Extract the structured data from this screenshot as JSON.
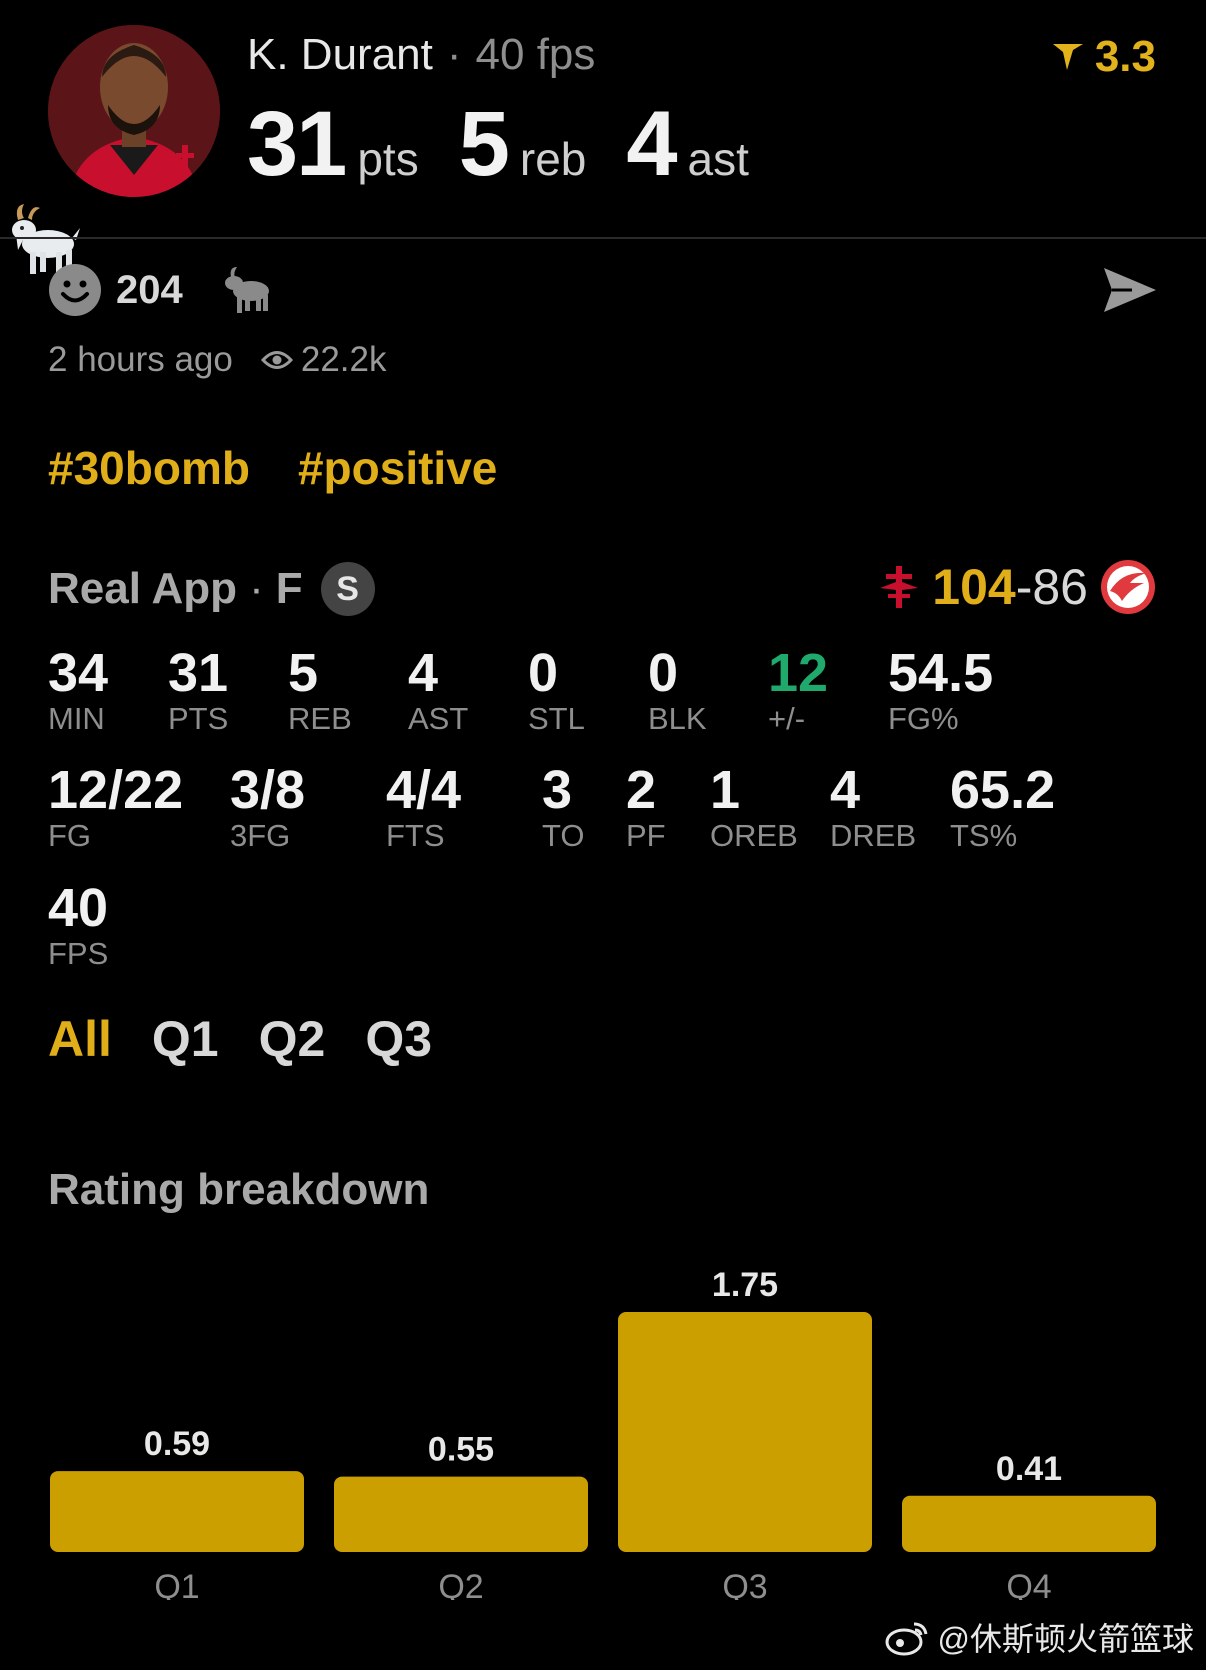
{
  "player": {
    "name": "K. Durant",
    "fps_label": "40 fps",
    "rating": "3.3",
    "stats": [
      {
        "value": "31",
        "unit": "pts"
      },
      {
        "value": "5",
        "unit": "reb"
      },
      {
        "value": "4",
        "unit": "ast"
      }
    ]
  },
  "reactions": {
    "count": "204"
  },
  "meta": {
    "time": "2 hours ago",
    "views": "22.2k"
  },
  "tags": [
    "#30bomb",
    "#positive"
  ],
  "game": {
    "title": "Real App",
    "position": "F",
    "badge": "S",
    "home_score": "104",
    "dash": "-",
    "away_score": "86"
  },
  "box_score": {
    "row1": [
      {
        "value": "34",
        "label": "MIN"
      },
      {
        "value": "31",
        "label": "PTS"
      },
      {
        "value": "5",
        "label": "REB"
      },
      {
        "value": "4",
        "label": "AST"
      },
      {
        "value": "0",
        "label": "STL"
      },
      {
        "value": "0",
        "label": "BLK"
      },
      {
        "value": "12",
        "label": "+/-"
      },
      {
        "value": "54.5",
        "label": "FG%"
      }
    ],
    "row2": [
      {
        "value": "12/22",
        "label": "FG"
      },
      {
        "value": "3/8",
        "label": "3FG"
      },
      {
        "value": "4/4",
        "label": "FTS"
      },
      {
        "value": "3",
        "label": "TO"
      },
      {
        "value": "2",
        "label": "PF"
      },
      {
        "value": "1",
        "label": "OREB"
      },
      {
        "value": "4",
        "label": "DREB"
      },
      {
        "value": "65.2",
        "label": "TS%"
      }
    ],
    "row3": [
      {
        "value": "40",
        "label": "FPS"
      }
    ]
  },
  "tabs": [
    "All",
    "Q1",
    "Q2",
    "Q3"
  ],
  "active_tab": "All",
  "rating_breakdown": {
    "title": "Rating breakdown"
  },
  "chart_data": {
    "type": "bar",
    "categories": [
      "Q1",
      "Q2",
      "Q3",
      "Q4"
    ],
    "values": [
      0.59,
      0.55,
      1.75,
      0.41
    ],
    "data_labels": [
      "0.59",
      "0.55",
      "1.75",
      "0.41"
    ],
    "title": "",
    "xlabel": "",
    "ylabel": "",
    "ylim": [
      0,
      1.75
    ],
    "grid": false,
    "bar_color": "#cc9f00"
  },
  "colors": {
    "accent": "#e0ae19",
    "positive": "#1fa96d",
    "bar": "#cc9f00"
  },
  "watermark": "@休斯顿火箭篮球"
}
